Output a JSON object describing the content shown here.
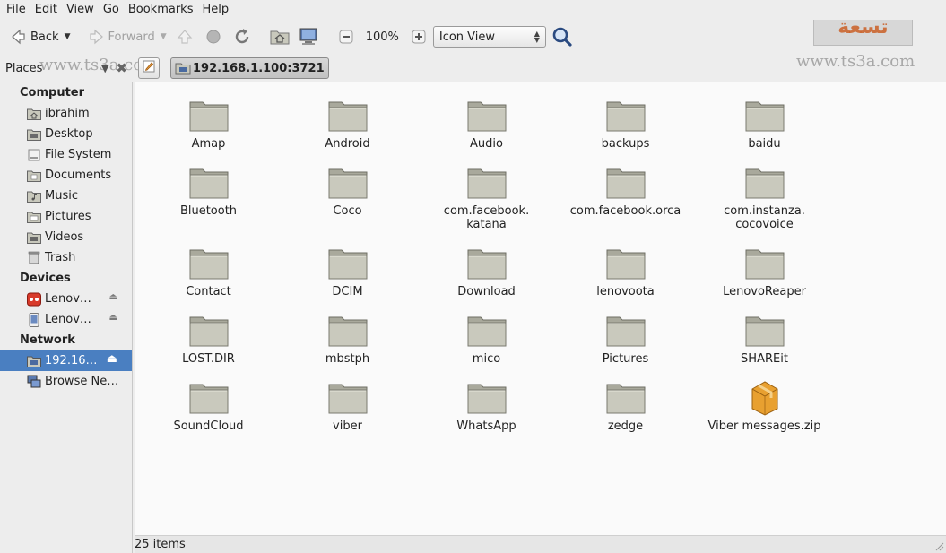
{
  "menubar": {
    "items": [
      "File",
      "Edit",
      "View",
      "Go",
      "Bookmarks",
      "Help"
    ]
  },
  "toolbar": {
    "back_label": "Back",
    "forward_label": "Forward",
    "zoom_level": "100%",
    "view_mode": "Icon View"
  },
  "location": {
    "places_label": "Places",
    "path_button": "192.168.1.100:3721"
  },
  "sidebar": {
    "computer_heading": "Computer",
    "computer_items": [
      {
        "label": "ibrahim",
        "icon": "home-folder-icon"
      },
      {
        "label": "Desktop",
        "icon": "desktop-folder-icon"
      },
      {
        "label": "File System",
        "icon": "filesystem-icon"
      },
      {
        "label": "Documents",
        "icon": "folder-icon"
      },
      {
        "label": "Music",
        "icon": "folder-icon"
      },
      {
        "label": "Pictures",
        "icon": "folder-icon"
      },
      {
        "label": "Videos",
        "icon": "folder-icon"
      },
      {
        "label": "Trash",
        "icon": "trash-icon"
      }
    ],
    "devices_heading": "Devices",
    "devices_items": [
      {
        "label": "Lenov…",
        "icon": "camera-device-icon"
      },
      {
        "label": "Lenov…",
        "icon": "phone-device-icon"
      }
    ],
    "network_heading": "Network",
    "network_items": [
      {
        "label": "192.16…",
        "icon": "network-share-icon",
        "selected": true
      },
      {
        "label": "Browse Ne…",
        "icon": "network-icon",
        "selected": false
      }
    ]
  },
  "files": [
    {
      "name": "Amap",
      "type": "folder"
    },
    {
      "name": "Android",
      "type": "folder"
    },
    {
      "name": "Audio",
      "type": "folder"
    },
    {
      "name": "backups",
      "type": "folder"
    },
    {
      "name": "baidu",
      "type": "folder"
    },
    {
      "name": "Bluetooth",
      "type": "folder"
    },
    {
      "name": "Coco",
      "type": "folder"
    },
    {
      "name": "com.facebook.\nkatana",
      "type": "folder"
    },
    {
      "name": "com.facebook.orca",
      "type": "folder"
    },
    {
      "name": "com.instanza.\ncocovoice",
      "type": "folder"
    },
    {
      "name": "Contact",
      "type": "folder"
    },
    {
      "name": "DCIM",
      "type": "folder"
    },
    {
      "name": "Download",
      "type": "folder"
    },
    {
      "name": "lenovoota",
      "type": "folder"
    },
    {
      "name": "LenovoReaper",
      "type": "folder"
    },
    {
      "name": "LOST.DIR",
      "type": "folder"
    },
    {
      "name": "mbstph",
      "type": "folder"
    },
    {
      "name": "mico",
      "type": "folder"
    },
    {
      "name": "Pictures",
      "type": "folder"
    },
    {
      "name": "SHAREit",
      "type": "folder"
    },
    {
      "name": "SoundCloud",
      "type": "folder"
    },
    {
      "name": "viber",
      "type": "folder"
    },
    {
      "name": "WhatsApp",
      "type": "folder"
    },
    {
      "name": "zedge",
      "type": "folder"
    },
    {
      "name": "Viber messages.zip",
      "type": "archive"
    }
  ],
  "status": {
    "items_count": "25 items"
  },
  "watermark": {
    "site": "www.ts3a.com",
    "logo_text": "تسعة"
  },
  "colors": {
    "selection": "#4a7fc1",
    "folder": "#bdbdb0"
  }
}
